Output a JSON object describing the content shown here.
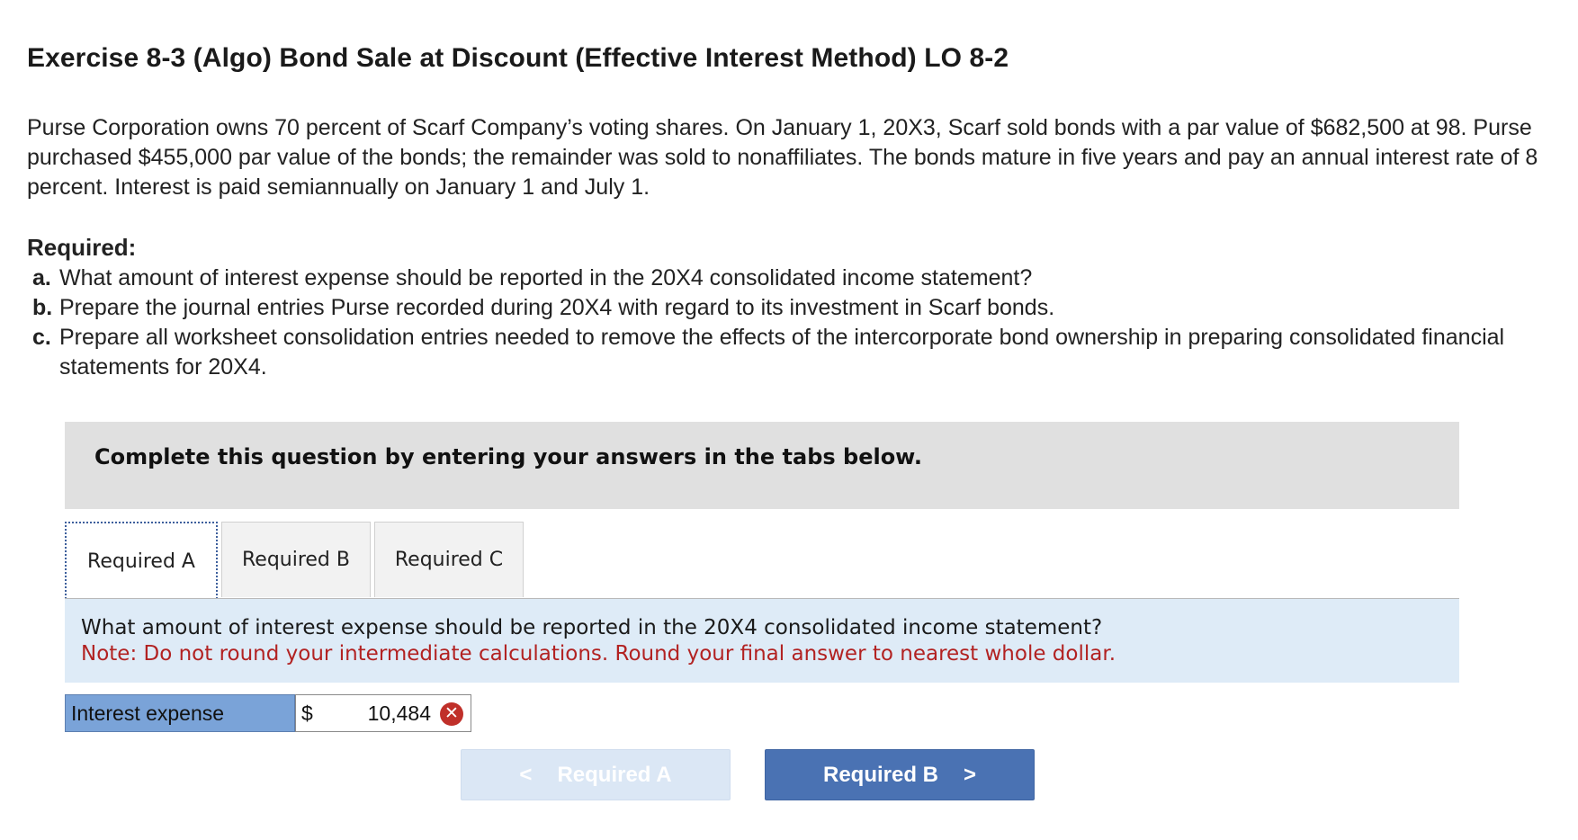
{
  "page": {
    "title": "Exercise 8-3 (Algo) Bond Sale at Discount (Effective Interest Method) LO 8-2"
  },
  "problem": {
    "intro": "Purse Corporation owns 70 percent of Scarf Company’s voting shares. On January 1, 20X3, Scarf sold bonds with a par value of $682,500 at 98. Purse purchased $455,000 par value of the bonds; the remainder was sold to nonaffiliates. The bonds mature in five years and pay an annual interest rate of 8 percent. Interest is paid semiannually on January 1 and July 1.",
    "required_heading": "Required:",
    "requirements": [
      {
        "label": "a.",
        "text": "What amount of interest expense should be reported in the 20X4 consolidated income statement?"
      },
      {
        "label": "b.",
        "text": "Prepare the journal entries Purse recorded during 20X4 with regard to its investment in Scarf bonds."
      },
      {
        "label": "c.",
        "text": "Prepare all worksheet consolidation entries needed to remove the effects of the intercorporate bond ownership in preparing consolidated financial statements for 20X4."
      }
    ]
  },
  "banner": {
    "text": "Complete this question by entering your answers in the tabs below."
  },
  "tabs": [
    {
      "label": "Required A",
      "active": true
    },
    {
      "label": "Required B",
      "active": false
    },
    {
      "label": "Required C",
      "active": false
    }
  ],
  "question": {
    "text": "What amount of interest expense should be reported in the 20X4 consolidated income statement?",
    "note": "Note: Do not round your intermediate calculations. Round your final answer to nearest whole dollar."
  },
  "answer": {
    "label": "Interest expense",
    "currency": "$",
    "value": "10,484",
    "status": "incorrect",
    "status_icon": "x-circle-icon",
    "status_color": "#c0302a"
  },
  "navigation": {
    "prev_label": "Required A",
    "next_label": "Required B",
    "prev_icon": "chevron-left-icon",
    "next_icon": "chevron-right-icon",
    "prev_glyph": "<",
    "next_glyph": ">",
    "prev_enabled": false,
    "next_color": "#4a72b3"
  }
}
